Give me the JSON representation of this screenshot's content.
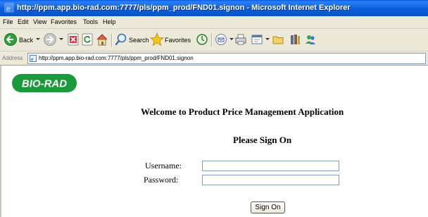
{
  "window": {
    "title": "http://ppm.app.bio-rad.com:7777/pls/ppm_prod/FND01.signon - Microsoft Internet Explorer"
  },
  "menubar": {
    "items": [
      "File",
      "Edit",
      "View",
      "Favorites",
      "Tools",
      "Help"
    ]
  },
  "toolbar": {
    "back_label": "Back",
    "search_label": "Search",
    "favorites_label": "Favorites"
  },
  "address": {
    "label": "Address",
    "url": "http://ppm.app.bio-rad.com:7777/pls/ppm_prod/FND01.signon"
  },
  "page": {
    "logo_text": "BIO-RAD",
    "welcome_heading": "Welcome to Product Price Management Application",
    "signon_heading": "Please Sign On",
    "username_label": "Username:",
    "password_label": "Password:",
    "username_value": "",
    "password_value": "",
    "signon_button": "Sign On",
    "brand_color": "#1a9a3a"
  }
}
